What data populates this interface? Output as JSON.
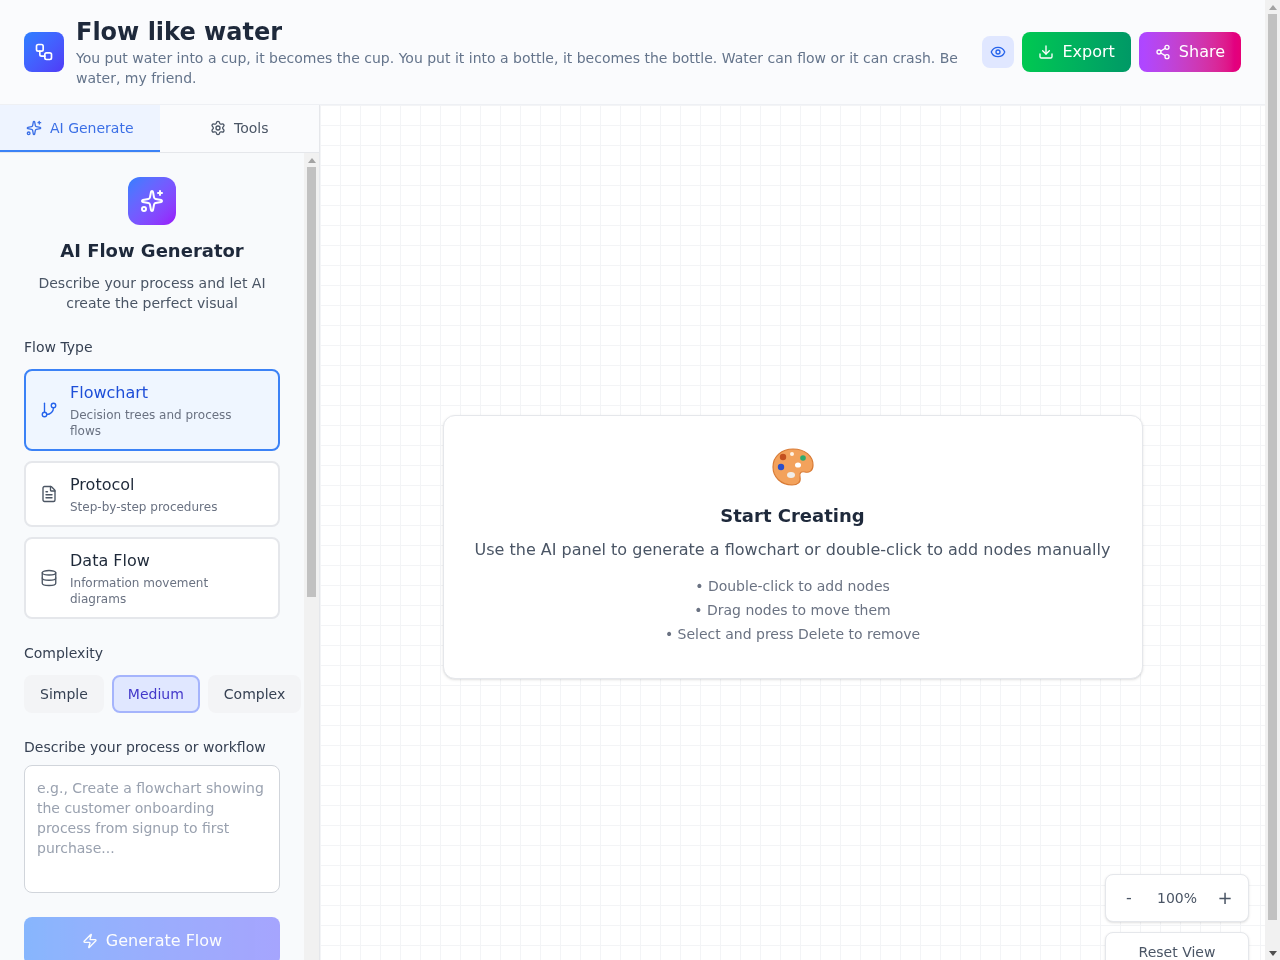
{
  "header": {
    "title": "Flow like water",
    "subtitle": "You put water into a cup, it becomes the cup. You put it into a bottle, it becomes the bottle. Water can flow or it can crash. Be water, my friend.",
    "actions": [
      {
        "kind": "export",
        "label": "Export"
      },
      {
        "kind": "share",
        "label": "Share"
      }
    ]
  },
  "sidebar": {
    "tabs": [
      {
        "kind": "ai",
        "label": "AI Generate",
        "selected": true
      },
      {
        "kind": "tools",
        "label": "Tools",
        "selected": false
      }
    ],
    "generator": {
      "title": "AI Flow Generator",
      "description": "Describe your process and let AI create the perfect visual"
    },
    "flow_type": {
      "label": "Flow Type",
      "options": [
        {
          "kind": "flowchart",
          "title": "Flowchart",
          "description": "Decision trees and process flows",
          "selected": true
        },
        {
          "kind": "protocol",
          "title": "Protocol",
          "description": "Step-by-step procedures",
          "selected": false
        },
        {
          "kind": "data_flow",
          "title": "Data Flow",
          "description": "Information movement diagrams",
          "selected": false
        }
      ]
    },
    "complexity": {
      "label": "Complexity",
      "options": [
        {
          "label": "Simple",
          "selected": false
        },
        {
          "label": "Medium",
          "selected": true
        },
        {
          "label": "Complex",
          "selected": false
        }
      ]
    },
    "prompt": {
      "label": "Describe your process or workflow",
      "placeholder": "e.g., Create a flowchart showing the customer onboarding process from signup to first purchase..."
    },
    "generate_button": {
      "label": "Generate Flow",
      "disabled": true
    }
  },
  "canvas": {
    "empty_state": {
      "title": "Start Creating",
      "description": "Use the AI panel to generate a flowchart or double-click to add nodes manually",
      "tips": [
        "• Double-click to add nodes",
        "• Drag nodes to move them",
        "• Select and press Delete to remove"
      ]
    },
    "zoom": {
      "decrease": "-",
      "level": "100%",
      "increase": "+"
    },
    "reset_button": "Reset View"
  }
}
